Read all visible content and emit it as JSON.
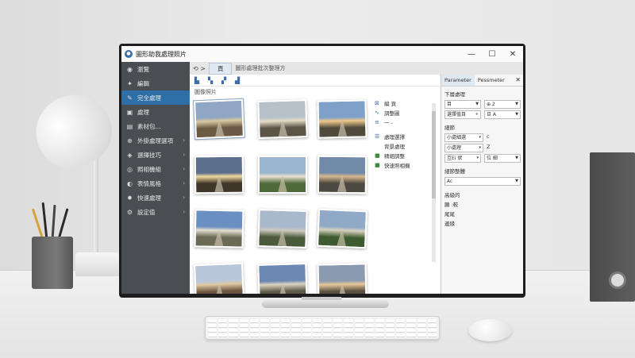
{
  "window": {
    "title": "圖形助我處理照片",
    "controls": [
      "—",
      "☐",
      "✕"
    ]
  },
  "sidebar": {
    "items": [
      {
        "label": "瀏覽",
        "icon": "eye-icon",
        "glyph": "◉",
        "chev": false,
        "active": false
      },
      {
        "label": "編輯",
        "icon": "sparkle-icon",
        "glyph": "✦",
        "chev": false,
        "active": false
      },
      {
        "label": "完全處理",
        "icon": "wand-icon",
        "glyph": "✎",
        "chev": false,
        "active": true
      },
      {
        "label": "處理",
        "icon": "image-icon",
        "glyph": "▣",
        "chev": false,
        "active": false
      },
      {
        "label": "素材包...",
        "icon": "layers-icon",
        "glyph": "▤",
        "chev": false,
        "active": false
      },
      {
        "label": "外掛處理選項",
        "icon": "plugin-icon",
        "glyph": "⊕",
        "chev": true,
        "active": false
      },
      {
        "label": "選擇技巧",
        "icon": "select-icon",
        "glyph": "◈",
        "chev": true,
        "active": false
      },
      {
        "label": "照相機組",
        "icon": "camera-icon",
        "glyph": "◎",
        "chev": true,
        "active": false
      },
      {
        "label": "表情風格",
        "icon": "style-icon",
        "glyph": "◐",
        "chev": true,
        "active": false
      },
      {
        "label": "快速處理",
        "icon": "gear-icon",
        "glyph": "✹",
        "chev": true,
        "active": false
      },
      {
        "label": "設定值",
        "icon": "settings-icon",
        "glyph": "⚙",
        "chev": true,
        "active": false
      }
    ]
  },
  "topbar": {
    "back": "⟲ >",
    "tab": "頁",
    "breadcrumb": "圖形處理批次整理方"
  },
  "toolbar": {
    "icons": [
      "save-icon",
      "copy-icon",
      "edit-icon",
      "stack-icon"
    ],
    "glyphs": [
      "▙",
      "▚",
      "▞",
      "▟"
    ]
  },
  "content": {
    "subheading": "圖像照片"
  },
  "context_menu": [
    {
      "label": "編 頁",
      "icon": "crop-icon",
      "glyph": "⊠"
    },
    {
      "label": "調整圖",
      "icon": "chart-icon",
      "glyph": "∿"
    },
    {
      "label": "一 -",
      "icon": "list-icon",
      "glyph": "≡"
    },
    {
      "sep": true
    },
    {
      "label": "處理選擇",
      "icon": "layers-icon",
      "glyph": "☰"
    },
    {
      "label": "背景處理",
      "icon": "",
      "glyph": ""
    },
    {
      "label": "精細調整",
      "icon": "square-green-icon",
      "glyph": "■"
    },
    {
      "label": "快速照相機",
      "icon": "square-green-icon",
      "glyph": "■"
    }
  ],
  "panel": {
    "tabs": [
      "Parameter",
      "Pessmeter"
    ],
    "close": "✕",
    "section1": "下層處理",
    "row1": {
      "a": "目",
      "b": "⊕.2"
    },
    "row2": {
      "a": "選擇值目",
      "b": "旦 A"
    },
    "section2": "細節",
    "row3": {
      "a": "小處細選",
      "b": "c"
    },
    "row4": {
      "a": "小處理",
      "b": "Z"
    },
    "row5": {
      "a": "互Ei 狀",
      "b": "位 細"
    },
    "section3": "細節整體",
    "row6": {
      "a": "Ac"
    },
    "lines": [
      "高級的",
      "顯 :較",
      "尾尾",
      "邊緣"
    ]
  },
  "photos": [
    {
      "sky": "#8fa6c4",
      "ground": "#6b5a44",
      "mid": "#d9c9a0",
      "selected": true
    },
    {
      "sky": "#b7c1c9",
      "ground": "#5b5447",
      "mid": "#e6ddc8",
      "selected": false
    },
    {
      "sky": "#7fa0c8",
      "ground": "#4f4a3c",
      "mid": "#f0c98a",
      "selected": false
    },
    {
      "sky": "#5b6f8a",
      "ground": "#3f3528",
      "mid": "#f2d9a0",
      "selected": false
    },
    {
      "sky": "#9bb4cf",
      "ground": "#4e6a3a",
      "mid": "#e9e2d0",
      "selected": false
    },
    {
      "sky": "#708aa8",
      "ground": "#4c4a40",
      "mid": "#d8b890",
      "selected": false
    },
    {
      "sky": "#6b8fc0",
      "ground": "#6b6a55",
      "mid": "#e5e0d0",
      "selected": false
    },
    {
      "sky": "#a8b9cb",
      "ground": "#4a5a3a",
      "mid": "#cfcac0",
      "selected": false
    },
    {
      "sky": "#90a9c6",
      "ground": "#3e5a30",
      "mid": "#d8d2c0",
      "selected": false
    },
    {
      "sky": "#b8c8da",
      "ground": "#6b5540",
      "mid": "#e0c8a0",
      "selected": false
    },
    {
      "sky": "#6c88b4",
      "ground": "#5e5a4a",
      "mid": "#dcd4c0",
      "selected": false
    },
    {
      "sky": "#8a9bb0",
      "ground": "#5a5040",
      "mid": "#e6c898",
      "selected": false
    }
  ]
}
